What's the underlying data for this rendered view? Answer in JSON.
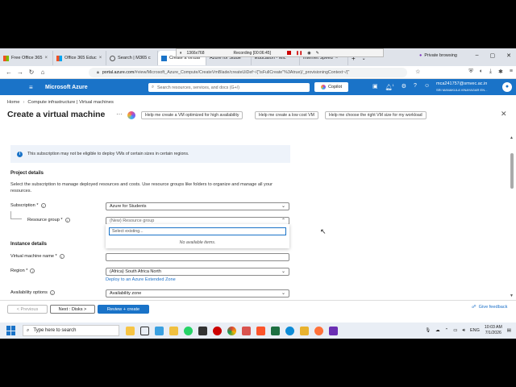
{
  "browser": {
    "tabs": [
      {
        "label": "Free Office 365"
      },
      {
        "label": "Office 365 Educ"
      },
      {
        "label": "Search | M365 c"
      },
      {
        "label": "Create a virtual"
      },
      {
        "label": "Azure for Stude"
      },
      {
        "label": "Education - Mic"
      },
      {
        "label": "Internet Speed"
      }
    ],
    "recording": {
      "resolution": "1366x768",
      "label": "Recording [00:06:45]"
    },
    "private_label": "Private browsing",
    "url_host": "portal.azure.com",
    "url_path": "/#view/Microsoft_Azure_Compute/CreateVmBlade/createUiDef~/{\"isFullCreate\"%3Atrue}/_provisioningContext~/{\""
  },
  "azure": {
    "title": "Microsoft Azure",
    "search_placeholder": "Search resources, services, and docs (G+/)",
    "copilot_label": "Copilot",
    "notifications_count": "1",
    "user_email": "mca241757@smvec.ac.in",
    "user_org": "SRI MANAKULA VINAYAGAR EN..."
  },
  "page": {
    "breadcrumb": [
      "Home",
      "Compute infrastructure | Virtual machines"
    ],
    "title": "Create a virtual machine",
    "chips": [
      "Help me create a VM optimized for high availability",
      "Help me create a low cost VM",
      "Help me choose the right VM size for my workload"
    ],
    "info_text": "This subscription may not be eligible to deploy VMs of certain sizes in certain regions.",
    "project_details": {
      "heading": "Project details",
      "description": "Select the subscription to manage deployed resources and costs. Use resource groups like folders to organize and manage all your resources.",
      "subscription_label": "Subscription *",
      "subscription_value": "Azure for Students",
      "resource_group_label": "Resource group *",
      "resource_group_value": "(New) Resource group",
      "dropdown_placeholder": "Select existing...",
      "dropdown_empty": "No available items."
    },
    "instance_details": {
      "heading": "Instance details",
      "vm_name_label": "Virtual machine name *",
      "vm_name_value": "",
      "region_label": "Region *",
      "region_value": "(Africa) South Africa North",
      "extended_zone_link": "Deploy to an Azure Extended Zone",
      "availability_label": "Availability options",
      "availability_value": "Availability zone"
    },
    "footer": {
      "previous": "< Previous",
      "next": "Next : Disks >",
      "review": "Review + create",
      "feedback": "Give feedback"
    }
  },
  "taskbar": {
    "search_placeholder": "Type here to search",
    "language": "ENG",
    "time": "10:03 AM",
    "date": "7/1/2026"
  }
}
